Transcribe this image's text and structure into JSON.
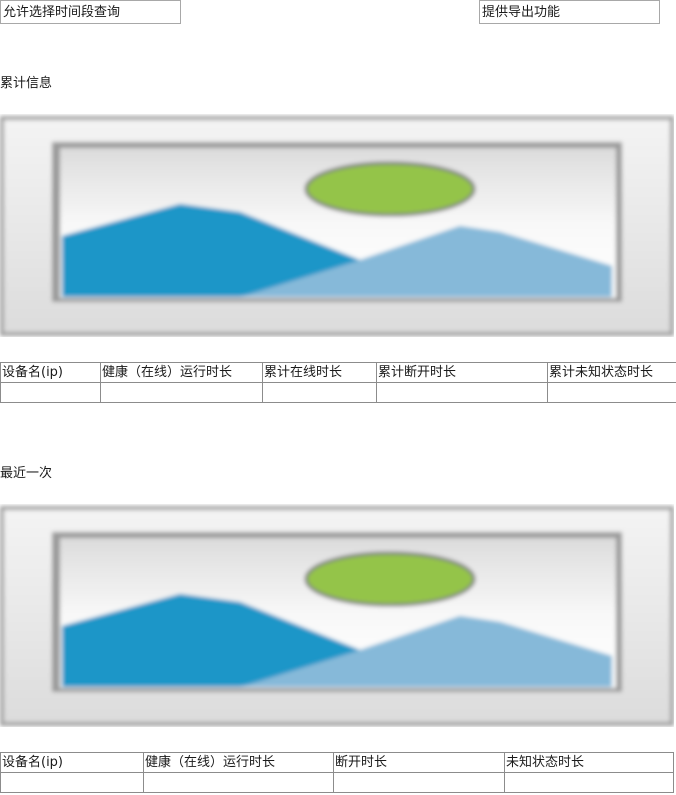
{
  "toolbar": {
    "query_button": "允许选择时间段查询",
    "export_button": "提供导出功能"
  },
  "sections": {
    "cumulative": {
      "title": "累计信息",
      "columns": [
        "设备名(ip)",
        "健康（在线）运行时长",
        "累计在线时长",
        "累计断开时长",
        "累计未知状态时长"
      ],
      "rows": [
        [
          "",
          "",
          "",
          "",
          ""
        ]
      ]
    },
    "recent": {
      "title": "最近一次",
      "columns": [
        "设备名(ip)",
        "健康（在线）运行时长",
        "断开时长",
        "未知状态时长"
      ],
      "rows": [
        [
          "",
          "",
          "",
          ""
        ]
      ]
    }
  },
  "image_placeholder": {
    "icon": "image-placeholder-icon",
    "colors": {
      "frame": "#e8e8e8",
      "mountain_dark": "#1a96c8",
      "mountain_light": "#86b9d9",
      "sun": "#94c44a"
    }
  }
}
